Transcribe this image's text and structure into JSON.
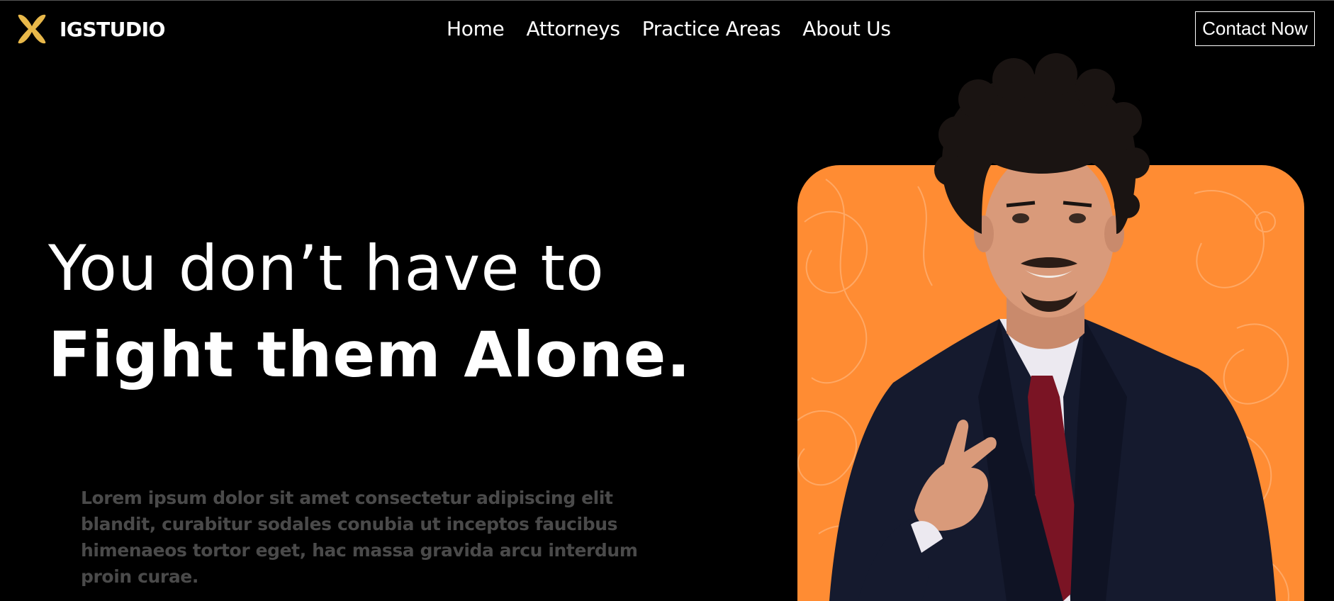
{
  "brand": {
    "name": "IGSTUDIO",
    "logo_icon": "x-mark-icon",
    "accent": "#e8b84a"
  },
  "nav": {
    "items": [
      {
        "label": "Home"
      },
      {
        "label": "Attorneys"
      },
      {
        "label": "Practice Areas"
      },
      {
        "label": "About Us"
      }
    ],
    "cta_label": "Contact Now"
  },
  "hero": {
    "headline_line1": "You don’t have to",
    "headline_line2": "Fight them Alone.",
    "lead": "Lorem ipsum dolor sit amet consectetur adipiscing elit blandit, curabitur sodales conubia ut inceptos faucibus himenaeos tortor eget, hac massa gravida arcu interdum proin curae.",
    "image": "attorney-portrait",
    "card_color": "#ff8c33"
  }
}
